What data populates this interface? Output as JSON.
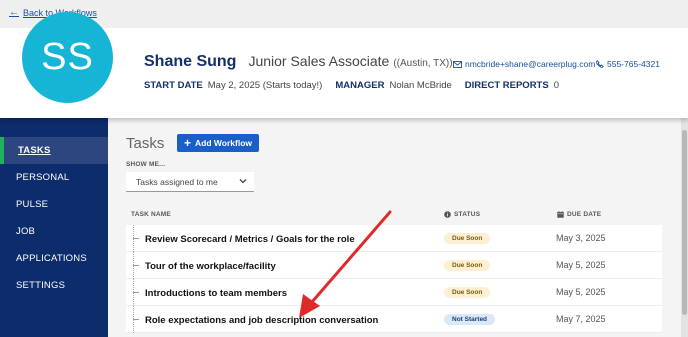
{
  "topbar": {
    "back_label": "Back to Workflows"
  },
  "employee": {
    "initials": "SS",
    "avatar_color": "#16b5d6",
    "name": "Shane Sung",
    "title": "Junior Sales Associate",
    "location": "((Austin, TX))",
    "email": "nmcbride+shane@careerplug.com",
    "phone": "555-765-4321",
    "start_date_label": "START DATE",
    "start_date_value": "May 2, 2025 (Starts today!)",
    "manager_label": "MANAGER",
    "manager_value": "Nolan McBride",
    "reports_label": "DIRECT REPORTS",
    "reports_value": "0"
  },
  "sidebar": {
    "items": [
      {
        "label": "TASKS",
        "active": true
      },
      {
        "label": "PERSONAL"
      },
      {
        "label": "PULSE"
      },
      {
        "label": "JOB"
      },
      {
        "label": "APPLICATIONS"
      },
      {
        "label": "SETTINGS"
      }
    ]
  },
  "main": {
    "title": "Tasks",
    "add_button": "Add Workflow",
    "show_me_label": "SHOW ME...",
    "filter_value": "Tasks assigned to me",
    "headers": {
      "task": "TASK NAME",
      "status": "STATUS",
      "due": "DUE DATE"
    },
    "rows": [
      {
        "name": "Review Scorecard / Metrics / Goals for the role",
        "status": "Due Soon",
        "due": "May 3, 2025"
      },
      {
        "name": "Tour of the workplace/facility",
        "status": "Due Soon",
        "due": "May 5, 2025"
      },
      {
        "name": "Introductions to team members",
        "status": "Due Soon",
        "due": "May 5, 2025"
      },
      {
        "name": "Role expectations and job description conversation",
        "status": "Not Started",
        "due": "May 7, 2025"
      }
    ]
  },
  "colors": {
    "sidebar": "#0c2c6b",
    "active_accent": "#1fb35a",
    "primary_button": "#1a5fc8",
    "annotation_arrow": "#e02a2a"
  }
}
